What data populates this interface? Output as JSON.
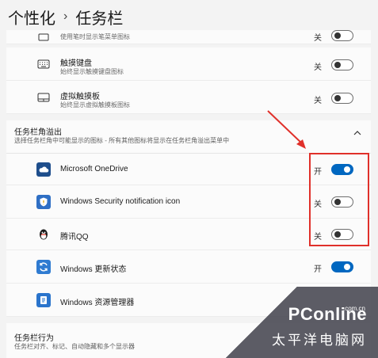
{
  "breadcrumb": {
    "parent": "个性化",
    "separator": "›",
    "current": "任务栏"
  },
  "top_rows": [
    {
      "title": "",
      "subtitle": "使用笔时显示笔菜单图标",
      "state": "关",
      "on": false
    },
    {
      "title": "触摸键盘",
      "subtitle": "始终显示触摸键盘图标",
      "state": "关",
      "on": false
    },
    {
      "title": "虚拟触摸板",
      "subtitle": "始终显示虚拟触摸板图标",
      "state": "关",
      "on": false
    }
  ],
  "overflow_section": {
    "title": "任务栏角溢出",
    "description": "选择任务栏角中可能显示的图标 - 所有其他图标将显示在任务栏角溢出菜单中",
    "items": [
      {
        "name": "Microsoft OneDrive",
        "state": "开",
        "on": true,
        "icon": "cloud-icon"
      },
      {
        "name": "Windows Security notification icon",
        "state": "关",
        "on": false,
        "icon": "security-shield-icon"
      },
      {
        "name": "腾讯QQ",
        "state": "关",
        "on": false,
        "icon": "qq-penguin-icon"
      },
      {
        "name": "Windows 更新状态",
        "state": "开",
        "on": true,
        "icon": "update-icon"
      },
      {
        "name": "Windows 资源管理器",
        "state": "",
        "on": null,
        "icon": "explorer-icon"
      }
    ]
  },
  "behavior_section": {
    "title": "任务栏行为",
    "description": "任务栏对齐、标记、自动隐藏和多个显示器"
  },
  "watermark": {
    "brand": "PConline",
    "domain": ".com.cn",
    "tagline": "太平洋电脑网"
  },
  "colors": {
    "accent": "#0067c0",
    "highlight": "#e0302a"
  }
}
